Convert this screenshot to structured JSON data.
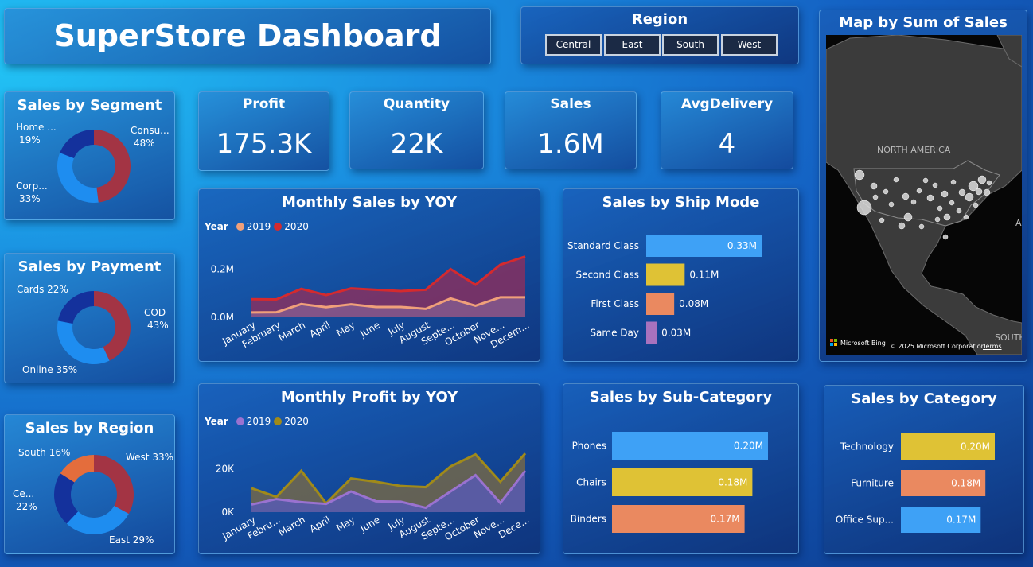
{
  "title": "SuperStore Dashboard",
  "region_slicer": {
    "title": "Region",
    "options": [
      "Central",
      "East",
      "South",
      "West"
    ]
  },
  "kpis": [
    {
      "label": "Profit",
      "value": "175.3K"
    },
    {
      "label": "Quantity",
      "value": "22K"
    },
    {
      "label": "Sales",
      "value": "1.6M"
    },
    {
      "label": "AvgDelivery",
      "value": "4"
    }
  ],
  "map": {
    "title": "Map by Sum of Sales",
    "continent_label": "NORTH AMERICA",
    "south_label": "SOUTH",
    "edge_label": "A",
    "attribution": "Microsoft Bing",
    "copyright": "© 2025 Microsoft Corporation",
    "terms": "Terms"
  },
  "colors": {
    "maroon": "#a33444",
    "blue": "#1e8df0",
    "navy": "#14319c",
    "orange": "#e46d3c",
    "bar_blue": "#3ea1f6",
    "bar_yellow": "#dfc235",
    "bar_orange": "#ea8960",
    "bar_purple": "#a872be"
  },
  "chart_data": [
    {
      "id": "segment",
      "type": "pie",
      "title": "Sales by Segment",
      "slices": [
        {
          "label": "Consu...",
          "pct": "48%",
          "value": 48,
          "color": "#a33444"
        },
        {
          "label": "Corp...",
          "pct": "33%",
          "value": 33,
          "color": "#1e8df0"
        },
        {
          "label": "Home ...",
          "pct": "19%",
          "value": 19,
          "color": "#14319c"
        }
      ]
    },
    {
      "id": "payment",
      "type": "pie",
      "title": "Sales by Payment",
      "slices": [
        {
          "label": "COD",
          "pct": "43%",
          "value": 43,
          "color": "#a33444"
        },
        {
          "label": "Online",
          "pct": "35%",
          "value": 35,
          "color": "#1e8df0"
        },
        {
          "label": "Cards",
          "pct": "22%",
          "value": 22,
          "color": "#14319c"
        }
      ]
    },
    {
      "id": "region",
      "type": "pie",
      "title": "Sales by Region",
      "slices": [
        {
          "label": "West",
          "pct": "33%",
          "value": 33,
          "color": "#a33444"
        },
        {
          "label": "East",
          "pct": "29%",
          "value": 29,
          "color": "#1e8df0"
        },
        {
          "label": "Ce...",
          "pct": "22%",
          "value": 22,
          "color": "#14319c"
        },
        {
          "label": "South",
          "pct": "16%",
          "value": 16,
          "color": "#e46d3c"
        }
      ]
    },
    {
      "id": "monthly_sales",
      "type": "area",
      "title": "Monthly Sales by YOY",
      "legend_title": "Year",
      "categories": [
        "January",
        "February",
        "March",
        "April",
        "May",
        "June",
        "July",
        "August",
        "Septe...",
        "October",
        "Nove...",
        "Decem..."
      ],
      "ylim": [
        0,
        0.3
      ],
      "yticks": [
        {
          "v": 0,
          "label": "0.0M"
        },
        {
          "v": 0.2,
          "label": "0.2M"
        }
      ],
      "series": [
        {
          "name": "2020",
          "color": "#d42a2e",
          "fill": "rgba(150,45,90,0.75)",
          "values": [
            0.075,
            0.074,
            0.118,
            0.092,
            0.12,
            0.114,
            0.109,
            0.114,
            0.2,
            0.135,
            0.218,
            0.252
          ]
        },
        {
          "name": "2019",
          "color": "#f0a07a",
          "fill": "rgba(140,110,160,0.55)",
          "values": [
            0.02,
            0.021,
            0.055,
            0.042,
            0.054,
            0.043,
            0.043,
            0.035,
            0.078,
            0.048,
            0.083,
            0.083
          ]
        }
      ]
    },
    {
      "id": "monthly_profit",
      "type": "area",
      "title": "Monthly Profit by YOY",
      "legend_title": "Year",
      "categories": [
        "January",
        "Febru...",
        "March",
        "April",
        "May",
        "June",
        "July",
        "August",
        "Septe...",
        "October",
        "Nove...",
        "Dece..."
      ],
      "ylim": [
        0,
        34000
      ],
      "yticks": [
        {
          "v": 0,
          "label": "0K"
        },
        {
          "v": 20000,
          "label": "20K"
        }
      ],
      "series": [
        {
          "name": "2020",
          "color": "#a08a1a",
          "fill": "rgba(120,105,70,0.8)",
          "values": [
            11000,
            7000,
            19000,
            4000,
            15500,
            14000,
            12000,
            11500,
            21000,
            26500,
            14000,
            27000
          ]
        },
        {
          "name": "2019",
          "color": "#9a72d0",
          "fill": "rgba(85,90,190,0.75)",
          "values": [
            3500,
            6000,
            4600,
            3800,
            9500,
            5000,
            4800,
            2000,
            9500,
            17000,
            4200,
            19000
          ]
        }
      ]
    },
    {
      "id": "ship_mode",
      "type": "bar",
      "title": "Sales by Ship Mode",
      "categories": [
        "Standard Class",
        "Second Class",
        "First Class",
        "Same Day"
      ],
      "values": [
        0.33,
        0.11,
        0.08,
        0.03
      ],
      "labels": [
        "0.33M",
        "0.11M",
        "0.08M",
        "0.03M"
      ],
      "colors": [
        "#3ea1f6",
        "#dfc235",
        "#ea8960",
        "#a872be"
      ]
    },
    {
      "id": "sub_category",
      "type": "bar",
      "title": "Sales by Sub-Category",
      "categories": [
        "Phones",
        "Chairs",
        "Binders"
      ],
      "values": [
        0.2,
        0.18,
        0.17
      ],
      "labels": [
        "0.20M",
        "0.18M",
        "0.17M"
      ],
      "colors": [
        "#3ea1f6",
        "#dfc235",
        "#ea8960"
      ]
    },
    {
      "id": "category",
      "type": "bar",
      "title": "Sales by Category",
      "categories": [
        "Technology",
        "Furniture",
        "Office Sup..."
      ],
      "values": [
        0.2,
        0.18,
        0.17
      ],
      "labels": [
        "0.20M",
        "0.18M",
        "0.17M"
      ],
      "colors": [
        "#dfc235",
        "#ea8960",
        "#3ea1f6"
      ]
    }
  ]
}
